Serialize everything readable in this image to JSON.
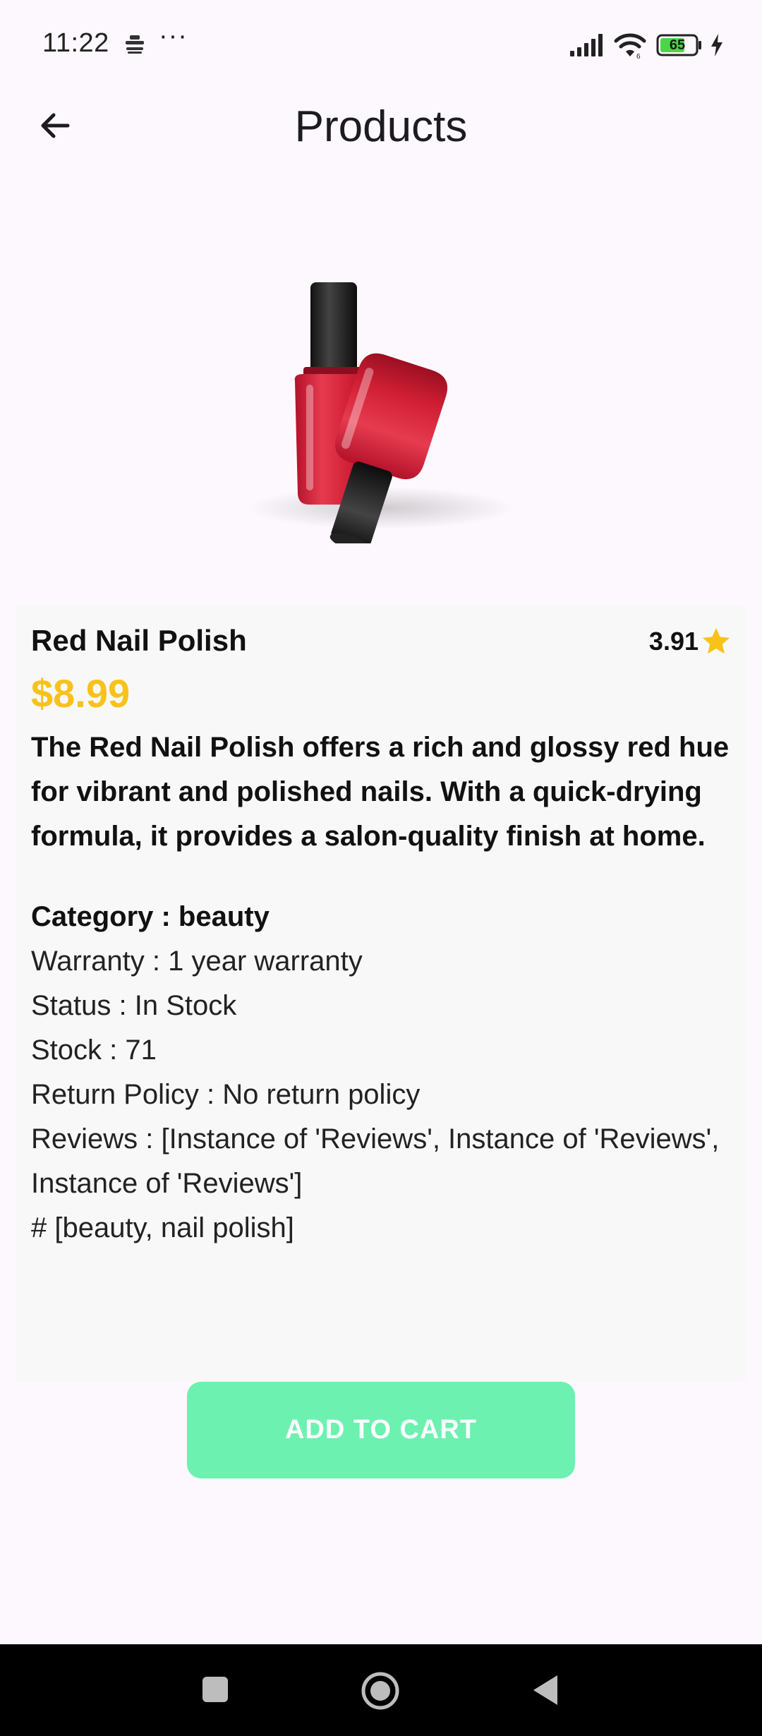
{
  "status_bar": {
    "time": "11:22",
    "more": "···",
    "battery": "65",
    "icons": [
      "notification-icon",
      "signal-icon",
      "wifi-icon",
      "battery-icon",
      "charging-icon"
    ]
  },
  "app_bar": {
    "title": "Products",
    "back_icon": "arrow-back-icon"
  },
  "product": {
    "name": "Red Nail Polish",
    "rating": "3.91",
    "price": "$8.99",
    "description": "The Red Nail Polish offers a rich and glossy red hue for vibrant and polished nails. With a quick-drying formula, it provides a salon-quality finish at home.",
    "category": "Category  : beauty",
    "warranty": "Warranty  : 1 year warranty",
    "status": "Status  : In Stock",
    "stock": "Stock  : 71",
    "return_policy": "Return Policy  : No return policy",
    "reviews": "Reviews  : [Instance of 'Reviews', Instance of 'Reviews', Instance of 'Reviews']",
    "tags": "# [beauty, nail polish]"
  },
  "actions": {
    "add_to_cart": "ADD TO CART"
  },
  "colors": {
    "price": "#f8c21b",
    "star": "#f8c21b",
    "button": "#6cf1b1",
    "card_bg": "#f7f8f7",
    "page_bg": "#fdf8fd"
  },
  "nav_bar": {
    "icons": [
      "recent-apps-icon",
      "home-icon",
      "back-icon"
    ]
  }
}
